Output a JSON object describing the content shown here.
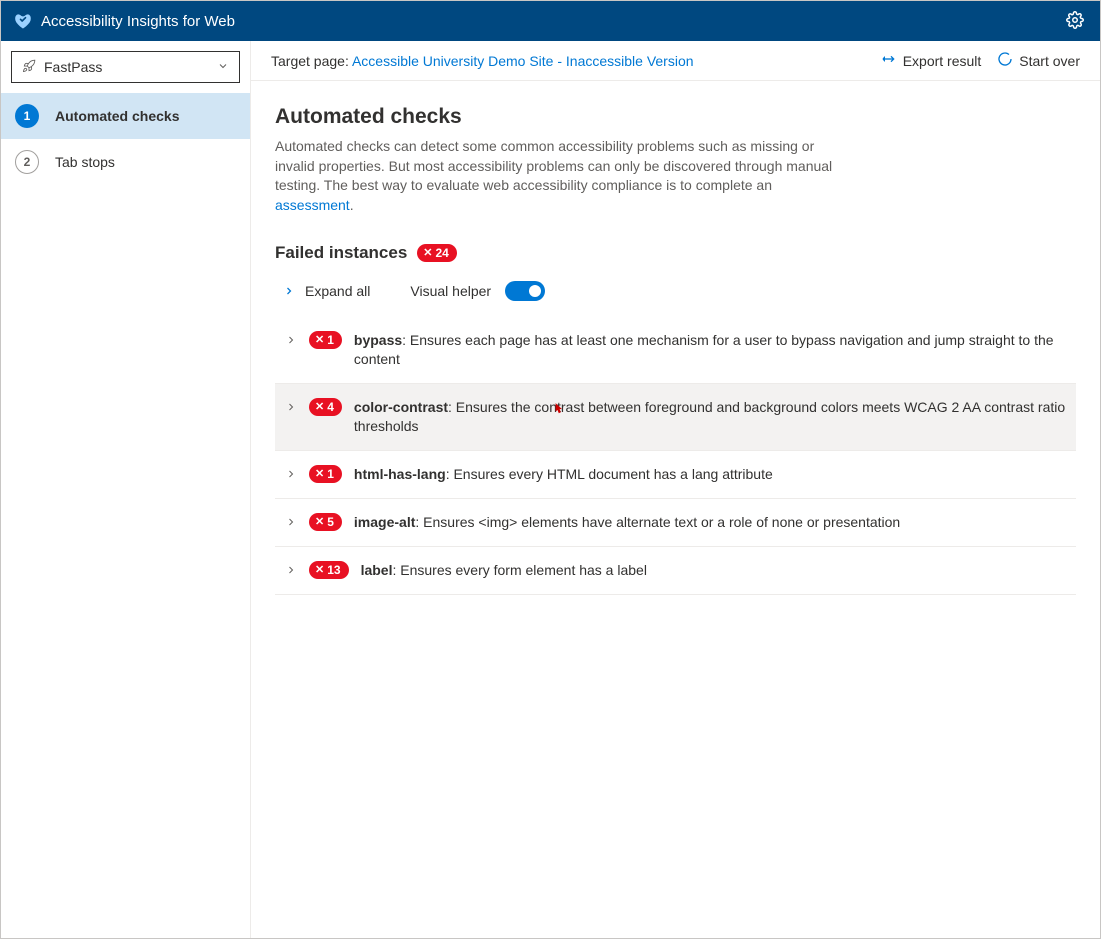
{
  "header": {
    "app_title": "Accessibility Insights for Web"
  },
  "sidebar": {
    "mode": "FastPass",
    "items": [
      {
        "step": "1",
        "label": "Automated checks",
        "active": true
      },
      {
        "step": "2",
        "label": "Tab stops",
        "active": false
      }
    ]
  },
  "topbar": {
    "target_label": "Target page: ",
    "target_link": "Accessible University Demo Site - Inaccessible Version",
    "export_label": "Export result",
    "startover_label": "Start over"
  },
  "content": {
    "title": "Automated checks",
    "desc_before": "Automated checks can detect some common accessibility problems such as missing or invalid properties. But most accessibility problems can only be discovered through manual testing. The best way to evaluate web accessibility compliance is to complete an ",
    "desc_link": "assessment",
    "desc_after": ".",
    "failed_title": "Failed instances",
    "total_badge": "24",
    "expand_all_label": "Expand all",
    "visual_helper_label": "Visual helper",
    "rules": [
      {
        "count": "1",
        "name": "bypass",
        "desc": ": Ensures each page has at least one mechanism for a user to bypass navigation and jump straight to the content",
        "hovered": false
      },
      {
        "count": "4",
        "name": "color-contrast",
        "desc": ": Ensures the contrast between foreground and background colors meets WCAG 2 AA contrast ratio thresholds",
        "hovered": true
      },
      {
        "count": "1",
        "name": "html-has-lang",
        "desc": ": Ensures every HTML document has a lang attribute",
        "hovered": false
      },
      {
        "count": "5",
        "name": "image-alt",
        "desc": ": Ensures <img> elements have alternate text or a role of none or presentation",
        "hovered": false
      },
      {
        "count": "13",
        "name": "label",
        "desc": ": Ensures every form element has a label",
        "hovered": false
      }
    ]
  }
}
